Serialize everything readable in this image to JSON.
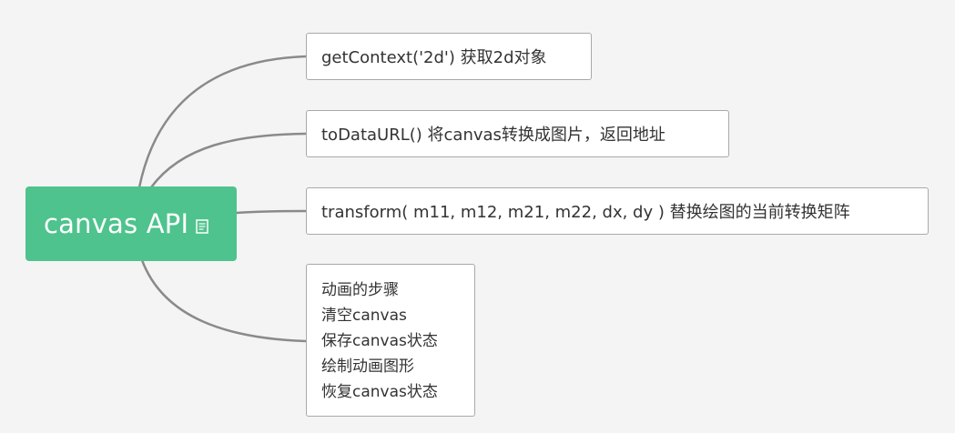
{
  "diagram": {
    "root": {
      "title": "canvas API",
      "icon": "note-icon",
      "color": "#4ec38d"
    },
    "children": [
      {
        "text": "getContext('2d') 获取2d对象"
      },
      {
        "text": "toDataURL() 将canvas转换成图片，返回地址"
      },
      {
        "text": "transform( m11, m12, m21, m22, dx, dy ) 替换绘图的当前转换矩阵"
      },
      {
        "lines": [
          "动画的步骤",
          "清空canvas",
          "保存canvas状态",
          "绘制动画图形",
          "恢复canvas状态"
        ]
      }
    ],
    "connector_color": "#8a8a8a"
  }
}
